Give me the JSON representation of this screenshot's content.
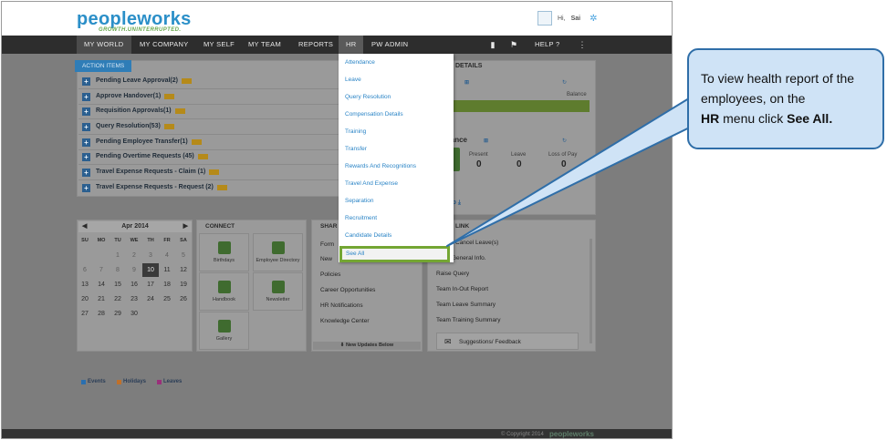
{
  "brand": {
    "logo": "peopleworks",
    "tagline": "GROWTH.UNINTERRUPTED."
  },
  "user": {
    "greeting": "Hi,",
    "name": "Sai"
  },
  "nav": {
    "items": [
      "MY WORLD",
      "MY COMPANY",
      "MY SELF",
      "MY TEAM",
      "REPORTS",
      "HR",
      "PW ADMIN"
    ],
    "help_label": "HELP"
  },
  "action_items": {
    "tab_label": "ACTION ITEMS",
    "rows": [
      "Pending Leave Approval(2)",
      "Approve Handover(1)",
      "Requisition Approvals(1)",
      "Query Resolution(53)",
      "Pending Employee Transfer(1)",
      "Pending Overtime Requests (45)",
      "Travel Expense Requests - Claim (1)",
      "Travel Expense Requests - Request (2)"
    ]
  },
  "details": {
    "header": "DETAILS",
    "balance_title": "e",
    "balance_label": "Balance",
    "attendance_title": "ndance",
    "stats": [
      {
        "label": "Present",
        "value": "0"
      },
      {
        "label": "Leave",
        "value": "0"
      },
      {
        "label": "Loss of Pay",
        "value": "0"
      }
    ],
    "salary_title": "y",
    "payslip_label": "yslip"
  },
  "calendar": {
    "month": "Apr 2014",
    "days_of_week": [
      "SU",
      "MO",
      "TU",
      "WE",
      "TH",
      "FR",
      "SA"
    ],
    "weeks": [
      [
        "",
        "",
        "1",
        "2",
        "3",
        "4",
        "5"
      ],
      [
        "6",
        "7",
        "8",
        "9",
        "10",
        "11",
        "12"
      ],
      [
        "13",
        "14",
        "15",
        "16",
        "17",
        "18",
        "19"
      ],
      [
        "20",
        "21",
        "22",
        "23",
        "24",
        "25",
        "26"
      ],
      [
        "27",
        "28",
        "29",
        "30",
        "",
        "",
        ""
      ]
    ],
    "today": "10",
    "legend": [
      {
        "label": "Events",
        "color": "#2a6fb0"
      },
      {
        "label": "Holidays",
        "color": "#c0702a"
      },
      {
        "label": "Leaves",
        "color": "#9a2f7a"
      }
    ]
  },
  "connect": {
    "header": "CONNECT",
    "tiles": [
      "Birthdays",
      "Employee Directory",
      "Handbook",
      "Newsletter",
      "Gallery"
    ]
  },
  "share": {
    "header": "SHAR",
    "items": [
      "Form",
      "New",
      "Policies",
      "Career Opportunities",
      "HR Notifications",
      "Knowledge Center"
    ],
    "updates_label": "New Updates Below"
  },
  "links": {
    "header": "LINK",
    "items": [
      "Cancel Leave(s)",
      "General Info.",
      "Raise Query",
      "Team In-Out Report",
      "Team Leave Summary",
      "Team Training Summary"
    ],
    "feedback_label": "Suggestions/ Feedback"
  },
  "hr_menu": {
    "items": [
      "Attendance",
      "Leave",
      "Query Resolution",
      "Compensation Details",
      "Training",
      "Transfer",
      "Rewards And Recognitions",
      "Travel And Expense",
      "Separation",
      "Recruitment",
      "Candidate Details"
    ],
    "see_all": "See All"
  },
  "footer": {
    "copyright": "© Copyright 2014",
    "logo": "peopleworks"
  },
  "callout": {
    "line1": "To view health report of the employees, on the",
    "menu": "HR",
    "line2": " menu click ",
    "action": "See All."
  },
  "colors": {
    "accent": "#2a84c6",
    "highlight": "#74a633",
    "callout_bg": "#cfe3f6",
    "callout_border": "#2f6ea8"
  }
}
